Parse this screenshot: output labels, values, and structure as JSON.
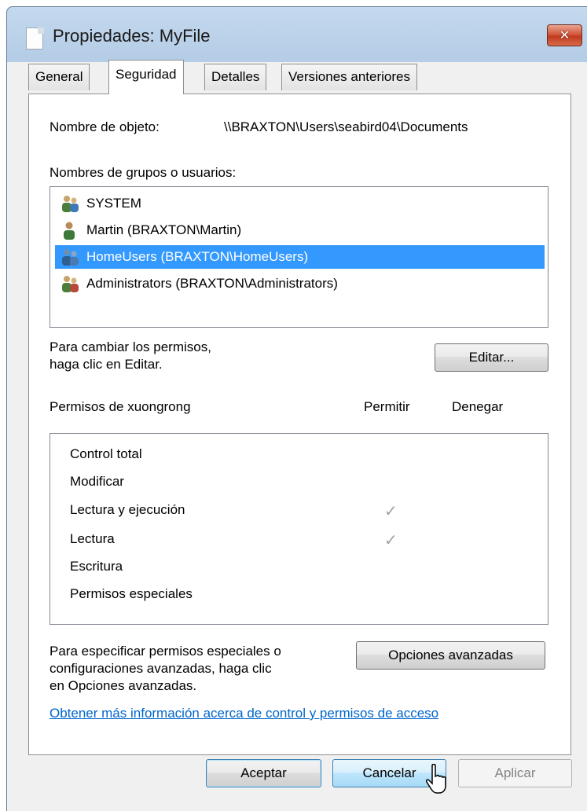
{
  "window": {
    "title": "Propiedades: MyFile"
  },
  "tabs": [
    {
      "label": "General",
      "active": false
    },
    {
      "label": "Seguridad",
      "active": true
    },
    {
      "label": "Detalles",
      "active": false
    },
    {
      "label": "Versiones anteriores",
      "active": false
    }
  ],
  "security": {
    "object_name_label": "Nombre de objeto:",
    "object_name_value": "\\\\BRAXTON\\Users\\seabird04\\Documents",
    "groups_label": "Nombres de grupos o usuarios:",
    "users": [
      {
        "name": "SYSTEM",
        "icon": "users-group-icon",
        "selected": false
      },
      {
        "name": "Martin (BRAXTON\\Martin)",
        "icon": "user-icon",
        "selected": false
      },
      {
        "name": "HomeUsers (BRAXTON\\HomeUsers)",
        "icon": "users-group-icon",
        "selected": true
      },
      {
        "name": "Administrators (BRAXTON\\Administrators)",
        "icon": "users-group-icon",
        "selected": false
      }
    ],
    "change_hint_line1": "Para cambiar los permisos,",
    "change_hint_line2": "haga clic en Editar.",
    "edit_button": "Editar...",
    "permissions_label": "Permisos de xuongrong",
    "allow_col": "Permitir",
    "deny_col": "Denegar",
    "permissions": [
      {
        "name": "Control total",
        "allow": false,
        "deny": false
      },
      {
        "name": "Modificar",
        "allow": false,
        "deny": false
      },
      {
        "name": "Lectura y ejecución",
        "allow": true,
        "deny": false
      },
      {
        "name": "Lectura",
        "allow": true,
        "deny": false
      },
      {
        "name": "Escritura",
        "allow": false,
        "deny": false
      },
      {
        "name": "Permisos especiales",
        "allow": false,
        "deny": false
      }
    ],
    "check_glyph": "✓",
    "advanced_hint_line1": "Para especificar permisos especiales o",
    "advanced_hint_line2": "configuraciones avanzadas, haga clic",
    "advanced_hint_line3": "en Opciones avanzadas.",
    "advanced_button": "Opciones avanzadas",
    "info_link": "Obtener más información acerca de control y permisos de acceso"
  },
  "footer": {
    "ok_button": "Aceptar",
    "cancel_button": "Cancelar",
    "apply_button": "Aplicar"
  },
  "colors": {
    "selection": "#3399ff",
    "link": "#0066cc",
    "close_button": "#c13c1f",
    "window_frame": "#bcd3ea"
  }
}
